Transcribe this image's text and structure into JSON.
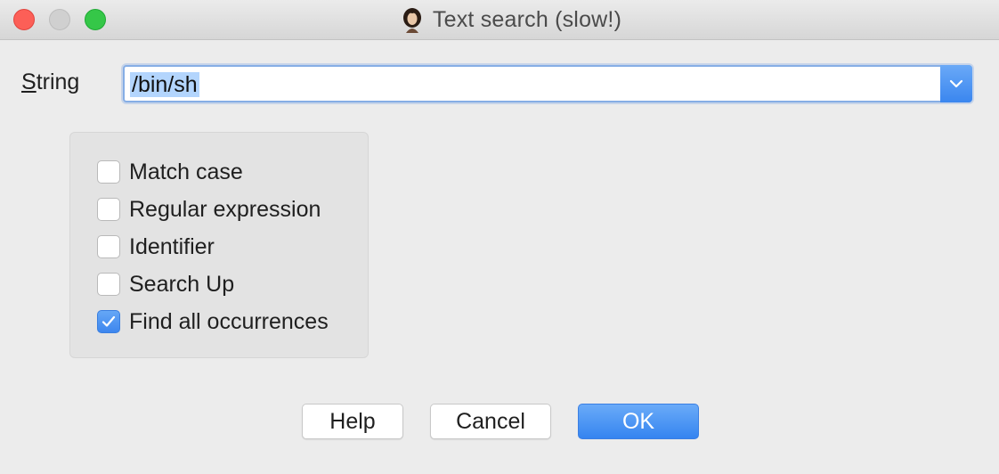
{
  "window": {
    "title": "Text search (slow!)"
  },
  "form": {
    "string_label_accel": "S",
    "string_label_rest": "tring",
    "string_value": "/bin/sh"
  },
  "options": [
    {
      "label": "Match case",
      "checked": false
    },
    {
      "label": "Regular expression",
      "checked": false
    },
    {
      "label": "Identifier",
      "checked": false
    },
    {
      "label": "Search Up",
      "checked": false
    },
    {
      "label": "Find all occurrences",
      "checked": true
    }
  ],
  "buttons": {
    "help": "Help",
    "cancel": "Cancel",
    "ok": "OK"
  },
  "colors": {
    "accent": "#3d86ee",
    "close": "#fc5f57",
    "minimize": "#d0d0d0",
    "maximize": "#35c748",
    "selection": "#b3d5fd"
  },
  "icons": {
    "app": "portrait-icon",
    "dropdown": "chevron-down-icon",
    "check": "checkmark-icon"
  }
}
